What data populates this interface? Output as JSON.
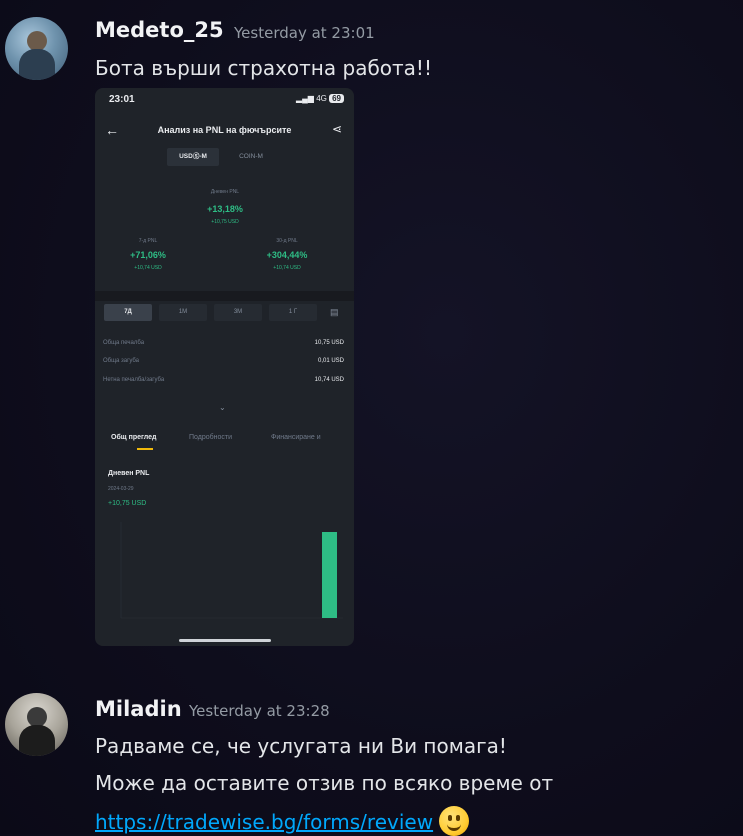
{
  "messages": [
    {
      "username": "Medeto_25",
      "timestamp": "Yesterday at 23:01",
      "text": "Бота върши страхотна работа!!",
      "attachment": {
        "status_time": "23:01",
        "status_right": "4G",
        "battery": "69",
        "title": "Анализ на PNL на фючърсите",
        "segments": [
          "USDⓈ-M",
          "COIN-M"
        ],
        "daily_label": "Дневен PNL",
        "daily_pct": "+13,18%",
        "daily_usd": "+10,75 USD",
        "left_label": "7-д PNL",
        "left_pct": "+71,06%",
        "left_usd": "+10,74 USD",
        "right_label": "30-д PNL",
        "right_pct": "+304,44%",
        "right_usd": "+10,74 USD",
        "period_tabs": [
          "7Д",
          "1М",
          "3М",
          "1 Г"
        ],
        "rows": [
          {
            "label": "Обща печалба",
            "value": "10,75 USD"
          },
          {
            "label": "Обща загуба",
            "value": "0,01 USD"
          },
          {
            "label": "Нетна печалба/загуба",
            "value": "10,74 USD"
          }
        ],
        "nav_tabs": [
          "Общ преглед",
          "Подробности",
          "Финансиране и"
        ],
        "chart_title": "Дневен PNL",
        "chart_date": "2024-03-29",
        "chart_value": "+10,75 USD",
        "chart_data": {
          "type": "bar",
          "values": [
            0,
            0,
            0,
            0,
            0,
            0,
            10.75
          ],
          "ylim": [
            0,
            12
          ]
        }
      }
    },
    {
      "username": "Miladin",
      "timestamp": "Yesterday at 23:28",
      "lines": [
        "Радваме се, че услугата ни Ви помага!",
        "Може да оставите отзив по всяко време от"
      ],
      "link": "https://tradewise.bg/forms/review",
      "emoji": "slightly-smiling-face-icon"
    }
  ]
}
